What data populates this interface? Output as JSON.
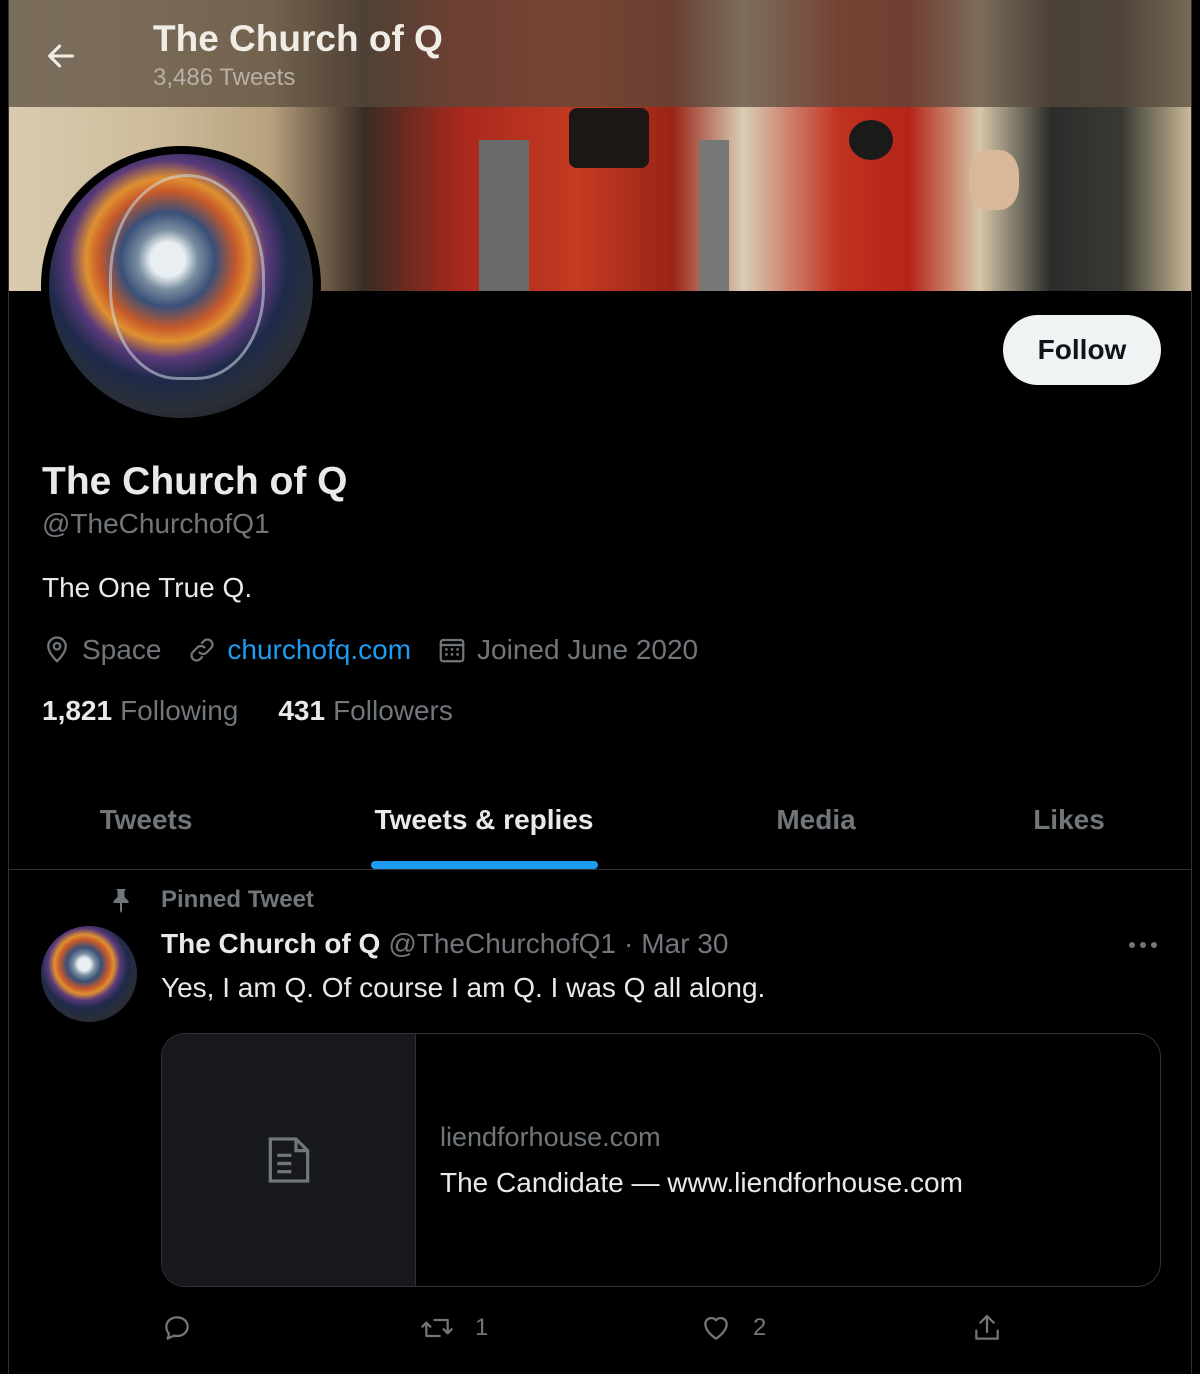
{
  "header": {
    "title": "The Church of Q",
    "tweet_count": "3,486 Tweets"
  },
  "profile": {
    "name": "The Church of Q",
    "handle": "@TheChurchofQ1",
    "bio": "The One True Q.",
    "location": "Space",
    "website": "churchofq.com",
    "joined": "Joined June 2020",
    "following_count": "1,821",
    "following_label": "Following",
    "followers_count": "431",
    "followers_label": "Followers",
    "follow_label": "Follow"
  },
  "tabs": [
    {
      "label": "Tweets"
    },
    {
      "label": "Tweets & replies"
    },
    {
      "label": "Media"
    },
    {
      "label": "Likes"
    }
  ],
  "pinned_tweet": {
    "pinned_label": "Pinned Tweet",
    "author_name": "The Church of Q",
    "author_handle": "@TheChurchofQ1",
    "separator": "·",
    "date": "Mar 30",
    "text": "Yes, I am Q. Of course I am Q. I was Q all along.",
    "card": {
      "domain": "liendforhouse.com",
      "title": "The Candidate — www.liendforhouse.com"
    },
    "retweets": "1",
    "likes": "2"
  },
  "icons": {
    "back": "arrow-left-icon",
    "location": "location-pin-icon",
    "link": "link-icon",
    "calendar": "calendar-icon",
    "pin": "pin-icon",
    "more": "more-horizontal-icon",
    "card": "document-icon",
    "reply": "reply-icon",
    "retweet": "retweet-icon",
    "like": "heart-icon",
    "share": "share-icon"
  },
  "colors": {
    "accent": "#1d9bf0",
    "background": "#000000",
    "text_primary": "#e7e9ea",
    "text_secondary": "#71767b"
  }
}
